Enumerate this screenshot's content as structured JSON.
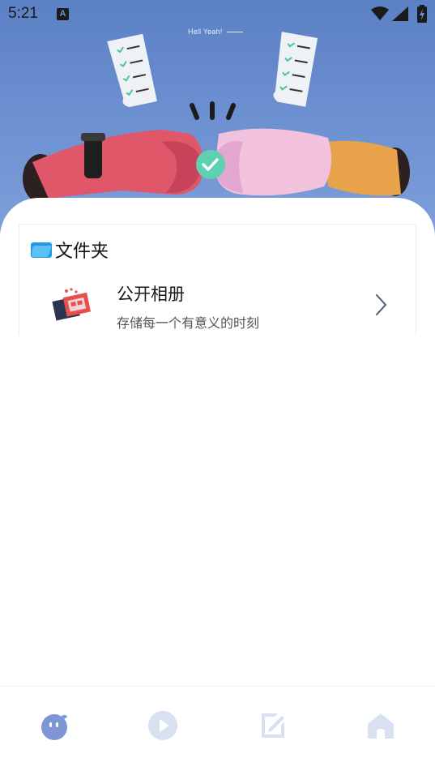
{
  "status_bar": {
    "time": "5:21",
    "notification_badge": "A"
  },
  "hero": {
    "caption": "Hell Yeah!"
  },
  "folder_section": {
    "title": "文件夹",
    "icon": "folder-icon",
    "items": [
      {
        "name": "公开相册",
        "description": "存储每一个有意义的时刻",
        "icon": "photo-album-icon"
      }
    ]
  },
  "bottom_nav": {
    "items": [
      {
        "icon": "mascot-face-icon",
        "active": true
      },
      {
        "icon": "play-icon",
        "active": false
      },
      {
        "icon": "edit-icon",
        "active": false
      },
      {
        "icon": "home-icon",
        "active": false
      }
    ]
  },
  "colors": {
    "hero_blue": "#6b8fd0",
    "accent": "#7f96d6",
    "inactive_icon": "#d9e0f2",
    "folder_blue": "#1f9be8"
  }
}
